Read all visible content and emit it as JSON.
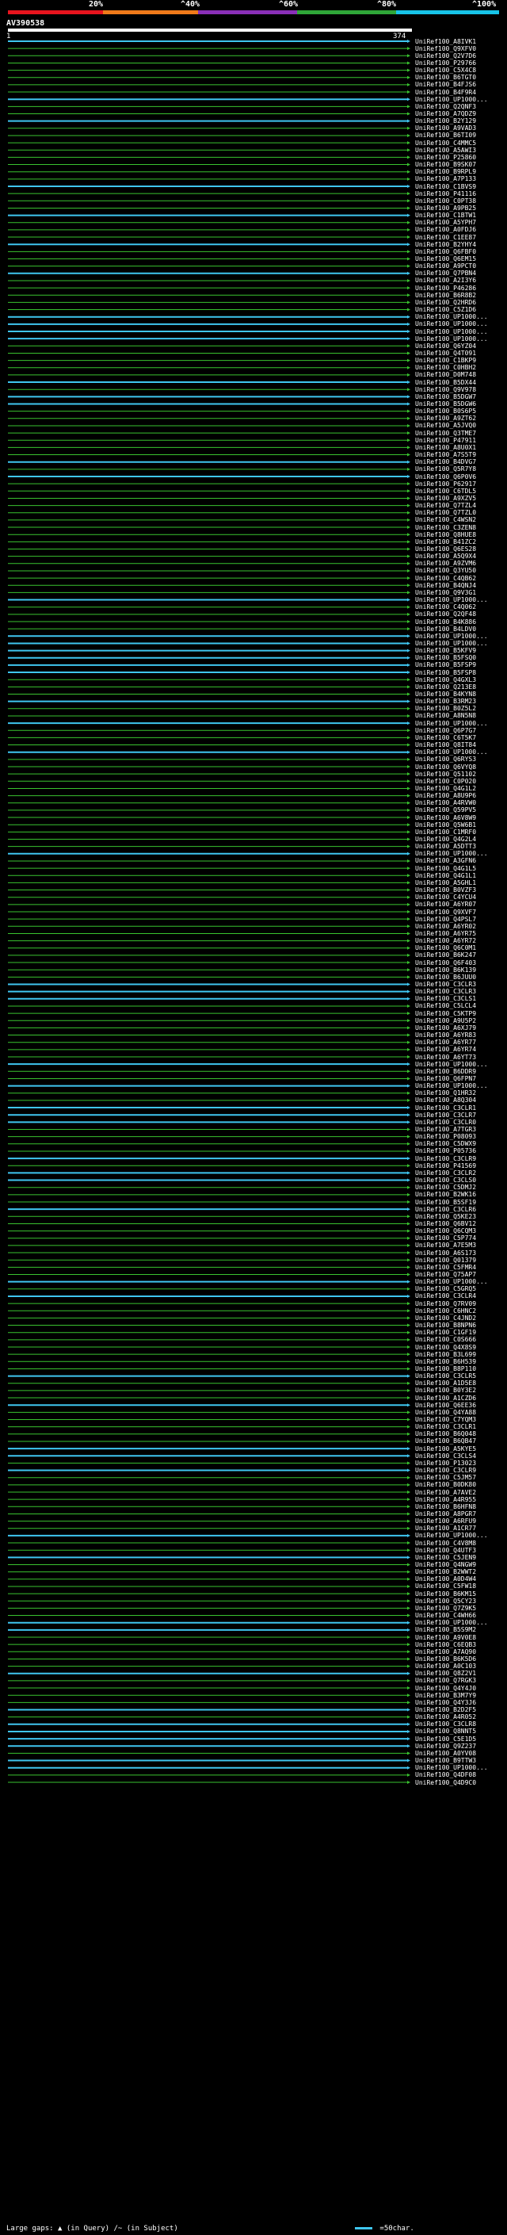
{
  "legend": {
    "ticks": [
      "20%",
      "^40%",
      "^60%",
      "^80%",
      "^100%"
    ],
    "colors": [
      "#e8141e",
      "#f07a1a",
      "#8a2fb8",
      "#2fa638",
      "#17c4e8"
    ]
  },
  "query": {
    "name": "AV390538",
    "start": "1",
    "end": "374"
  },
  "colors": {
    "green": "#39c22f",
    "cyan": "#3fc6f0",
    "stub": "#1f5a1f"
  },
  "hits": [
    {
      "label": "UniRef100_A8IVK1",
      "kind": "cyan"
    },
    {
      "label": "UniRef100_Q9XFV0",
      "kind": "green"
    },
    {
      "label": "UniRef100_Q2V7D6",
      "kind": "green"
    },
    {
      "label": "UniRef100_P29766",
      "kind": "green"
    },
    {
      "label": "UniRef100_C5X4C8",
      "kind": "green"
    },
    {
      "label": "UniRef100_B6TGT0",
      "kind": "green"
    },
    {
      "label": "UniRef100_B4FJS6",
      "kind": "green"
    },
    {
      "label": "UniRef100_B4F9R4",
      "kind": "green"
    },
    {
      "label": "UniRef100_UP1000...",
      "kind": "cyan"
    },
    {
      "label": "UniRef100_Q2QNF3",
      "kind": "green"
    },
    {
      "label": "UniRef100_A7QDZ9",
      "kind": "green"
    },
    {
      "label": "UniRef100_B2Y129",
      "kind": "cyan"
    },
    {
      "label": "UniRef100_A9VAD3",
      "kind": "green"
    },
    {
      "label": "UniRef100_B6TI09",
      "kind": "green"
    },
    {
      "label": "UniRef100_C4MMC5",
      "kind": "green"
    },
    {
      "label": "UniRef100_A5AWI3",
      "kind": "green"
    },
    {
      "label": "UniRef100_P25860",
      "kind": "green"
    },
    {
      "label": "UniRef100_B9SK07",
      "kind": "green"
    },
    {
      "label": "UniRef100_B9RPL9",
      "kind": "green"
    },
    {
      "label": "UniRef100_A7P133",
      "kind": "green"
    },
    {
      "label": "UniRef100_C1BVS9",
      "kind": "cyan"
    },
    {
      "label": "UniRef100_P41116",
      "kind": "green"
    },
    {
      "label": "UniRef100_C0PT38",
      "kind": "green"
    },
    {
      "label": "UniRef100_A9PB25",
      "kind": "green"
    },
    {
      "label": "UniRef100_C1BTW1",
      "kind": "cyan"
    },
    {
      "label": "UniRef100_A5YPH7",
      "kind": "green"
    },
    {
      "label": "UniRef100_A0FDJ6",
      "kind": "green"
    },
    {
      "label": "UniRef100_C1EE87",
      "kind": "green"
    },
    {
      "label": "UniRef100_B2YHY4",
      "kind": "cyan"
    },
    {
      "label": "UniRef100_Q6FBF0",
      "kind": "green"
    },
    {
      "label": "UniRef100_Q6EM15",
      "kind": "green"
    },
    {
      "label": "UniRef100_A9PCT0",
      "kind": "green"
    },
    {
      "label": "UniRef100_Q7PBN4",
      "kind": "cyan"
    },
    {
      "label": "UniRef100_A2I3Y6",
      "kind": "green"
    },
    {
      "label": "UniRef100_P46286",
      "kind": "green"
    },
    {
      "label": "UniRef100_B6R8B2",
      "kind": "green"
    },
    {
      "label": "UniRef100_Q2HRD6",
      "kind": "green"
    },
    {
      "label": "UniRef100_C5Z1D6",
      "kind": "green"
    },
    {
      "label": "UniRef100_UP1000...",
      "kind": "cyan"
    },
    {
      "label": "UniRef100_UP1000...",
      "kind": "cyan"
    },
    {
      "label": "UniRef100_UP1000...",
      "kind": "cyan"
    },
    {
      "label": "UniRef100_UP1000...",
      "kind": "cyan"
    },
    {
      "label": "UniRef100_Q6YZ04",
      "kind": "green"
    },
    {
      "label": "UniRef100_Q4T091",
      "kind": "green"
    },
    {
      "label": "UniRef100_C1BKP9",
      "kind": "green"
    },
    {
      "label": "UniRef100_C0HBH2",
      "kind": "green"
    },
    {
      "label": "UniRef100_D0M748",
      "kind": "green"
    },
    {
      "label": "UniRef100_B5DX44",
      "kind": "cyan"
    },
    {
      "label": "UniRef100_Q9V978",
      "kind": "green"
    },
    {
      "label": "UniRef100_B5DGW7",
      "kind": "cyan"
    },
    {
      "label": "UniRef100_B5DGW6",
      "kind": "cyan"
    },
    {
      "label": "UniRef100_B0S6P5",
      "kind": "green"
    },
    {
      "label": "UniRef100_A9ZT62",
      "kind": "green"
    },
    {
      "label": "UniRef100_A5JVQ0",
      "kind": "green"
    },
    {
      "label": "UniRef100_Q3TME7",
      "kind": "green"
    },
    {
      "label": "UniRef100_P47911",
      "kind": "green"
    },
    {
      "label": "UniRef100_A8U0X1",
      "kind": "green"
    },
    {
      "label": "UniRef100_A7S5T9",
      "kind": "green"
    },
    {
      "label": "UniRef100_B4DVG7",
      "kind": "cyan"
    },
    {
      "label": "UniRef100_Q5R7Y8",
      "kind": "green"
    },
    {
      "label": "UniRef100_Q6P0V6",
      "kind": "cyan"
    },
    {
      "label": "UniRef100_P62917",
      "kind": "green"
    },
    {
      "label": "UniRef100_C6TDL5",
      "kind": "green"
    },
    {
      "label": "UniRef100_A9XZV5",
      "kind": "green"
    },
    {
      "label": "UniRef100_Q7TZL4",
      "kind": "green"
    },
    {
      "label": "UniRef100_Q7TZL0",
      "kind": "green"
    },
    {
      "label": "UniRef100_C4WSN2",
      "kind": "green"
    },
    {
      "label": "UniRef100_C3ZEN8",
      "kind": "green"
    },
    {
      "label": "UniRef100_Q8HUE8",
      "kind": "green"
    },
    {
      "label": "UniRef100_B41ZC2",
      "kind": "green"
    },
    {
      "label": "UniRef100_Q6ES28",
      "kind": "green"
    },
    {
      "label": "UniRef100_A5Q9X4",
      "kind": "green"
    },
    {
      "label": "UniRef100_A9ZVM6",
      "kind": "green"
    },
    {
      "label": "UniRef100_Q3YU50",
      "kind": "green"
    },
    {
      "label": "UniRef100_C4QB62",
      "kind": "green"
    },
    {
      "label": "UniRef100_B4QNJ4",
      "kind": "green"
    },
    {
      "label": "UniRef100_Q9V3G1",
      "kind": "green"
    },
    {
      "label": "UniRef100_UP1000...",
      "kind": "cyan"
    },
    {
      "label": "UniRef100_C4Q062",
      "kind": "green"
    },
    {
      "label": "UniRef100_Q2QF48",
      "kind": "green"
    },
    {
      "label": "UniRef100_B4K886",
      "kind": "green"
    },
    {
      "label": "UniRef100_B4LDV0",
      "kind": "green"
    },
    {
      "label": "UniRef100_UP1000...",
      "kind": "cyan"
    },
    {
      "label": "UniRef100_UP1000...",
      "kind": "cyan"
    },
    {
      "label": "UniRef100_B5KFV9",
      "kind": "cyan"
    },
    {
      "label": "UniRef100_B5FSQ0",
      "kind": "cyan"
    },
    {
      "label": "UniRef100_B5FSP9",
      "kind": "cyan"
    },
    {
      "label": "UniRef100_B5FSP8",
      "kind": "cyan"
    },
    {
      "label": "UniRef100_Q4GXL3",
      "kind": "green"
    },
    {
      "label": "UniRef100_Q213E8",
      "kind": "green"
    },
    {
      "label": "UniRef100_B4KYN8",
      "kind": "green"
    },
    {
      "label": "UniRef100_B3RM23",
      "kind": "cyan"
    },
    {
      "label": "UniRef100_B0Z5L2",
      "kind": "green"
    },
    {
      "label": "UniRef100_A8N5N8",
      "kind": "green"
    },
    {
      "label": "UniRef100_UP1000...",
      "kind": "cyan"
    },
    {
      "label": "UniRef100_Q6P7G7",
      "kind": "green"
    },
    {
      "label": "UniRef100_C6T5K7",
      "kind": "green"
    },
    {
      "label": "UniRef100_Q8IT84",
      "kind": "green"
    },
    {
      "label": "UniRef100_UP1000...",
      "kind": "cyan"
    },
    {
      "label": "UniRef100_Q6RYS3",
      "kind": "green"
    },
    {
      "label": "UniRef100_Q6VYQ8",
      "kind": "green"
    },
    {
      "label": "UniRef100_Q51102",
      "kind": "green"
    },
    {
      "label": "UniRef100_C0P020",
      "kind": "green"
    },
    {
      "label": "UniRef100_Q4G1L2",
      "kind": "green"
    },
    {
      "label": "UniRef100_A8U9P6",
      "kind": "green"
    },
    {
      "label": "UniRef100_A4RVW0",
      "kind": "green"
    },
    {
      "label": "UniRef100_Q59PV5",
      "kind": "green"
    },
    {
      "label": "UniRef100_A6V8W9",
      "kind": "green"
    },
    {
      "label": "UniRef100_Q5W6B1",
      "kind": "green"
    },
    {
      "label": "UniRef100_C1MRF0",
      "kind": "green"
    },
    {
      "label": "UniRef100_Q4G2L4",
      "kind": "green"
    },
    {
      "label": "UniRef100_A5DTT3",
      "kind": "green"
    },
    {
      "label": "UniRef100_UP1000...",
      "kind": "cyan"
    },
    {
      "label": "UniRef100_A3GFN6",
      "kind": "green"
    },
    {
      "label": "UniRef100_Q4G1L5",
      "kind": "green"
    },
    {
      "label": "UniRef100_Q4G1L1",
      "kind": "green"
    },
    {
      "label": "UniRef100_A5GHL1",
      "kind": "green"
    },
    {
      "label": "UniRef100_B0VZF3",
      "kind": "green"
    },
    {
      "label": "UniRef100_C4YCU4",
      "kind": "green"
    },
    {
      "label": "UniRef100_A6YR07",
      "kind": "green"
    },
    {
      "label": "UniRef100_Q9XVF7",
      "kind": "green"
    },
    {
      "label": "UniRef100_Q4PSL7",
      "kind": "green"
    },
    {
      "label": "UniRef100_A6YR02",
      "kind": "green"
    },
    {
      "label": "UniRef100_A6YR75",
      "kind": "green"
    },
    {
      "label": "UniRef100_A6YR72",
      "kind": "green"
    },
    {
      "label": "UniRef100_Q6C0M1",
      "kind": "green"
    },
    {
      "label": "UniRef100_B6K247",
      "kind": "green"
    },
    {
      "label": "UniRef100_Q6F403",
      "kind": "green"
    },
    {
      "label": "UniRef100_B6K139",
      "kind": "green"
    },
    {
      "label": "UniRef100_B6JUU0",
      "kind": "green"
    },
    {
      "label": "UniRef100_C3CLR3",
      "kind": "cyan"
    },
    {
      "label": "UniRef100_C3CLR3",
      "kind": "cyan"
    },
    {
      "label": "UniRef100_C3CLS1",
      "kind": "cyan"
    },
    {
      "label": "UniRef100_C5LCL4",
      "kind": "green"
    },
    {
      "label": "UniRef100_C5KTP9",
      "kind": "green"
    },
    {
      "label": "UniRef100_A9U5P2",
      "kind": "green"
    },
    {
      "label": "UniRef100_A6XJ79",
      "kind": "green"
    },
    {
      "label": "UniRef100_A6YR83",
      "kind": "green"
    },
    {
      "label": "UniRef100_A6YR77",
      "kind": "green"
    },
    {
      "label": "UniRef100_A6YR74",
      "kind": "green"
    },
    {
      "label": "UniRef100_A6YT73",
      "kind": "green"
    },
    {
      "label": "UniRef100_UP1000...",
      "kind": "cyan"
    },
    {
      "label": "UniRef100_B6DDR9",
      "kind": "green"
    },
    {
      "label": "UniRef100_Q6FPN7",
      "kind": "green"
    },
    {
      "label": "UniRef100_UP1000...",
      "kind": "cyan"
    },
    {
      "label": "UniRef100_Q1HR32",
      "kind": "green"
    },
    {
      "label": "UniRef100_A8Q304",
      "kind": "green"
    },
    {
      "label": "UniRef100_C3CLR1",
      "kind": "cyan"
    },
    {
      "label": "UniRef100_C3CLR7",
      "kind": "cyan"
    },
    {
      "label": "UniRef100_C3CLR0",
      "kind": "cyan"
    },
    {
      "label": "UniRef100_A7TGR3",
      "kind": "green"
    },
    {
      "label": "UniRef100_P08093",
      "kind": "green"
    },
    {
      "label": "UniRef100_C5DWX9",
      "kind": "green"
    },
    {
      "label": "UniRef100_P05736",
      "kind": "green"
    },
    {
      "label": "UniRef100_C3CLR9",
      "kind": "cyan"
    },
    {
      "label": "UniRef100_P41569",
      "kind": "green"
    },
    {
      "label": "UniRef100_C3CLR2",
      "kind": "cyan"
    },
    {
      "label": "UniRef100_C3CLS0",
      "kind": "cyan"
    },
    {
      "label": "UniRef100_C5DMJ2",
      "kind": "green"
    },
    {
      "label": "UniRef100_B2WK16",
      "kind": "green"
    },
    {
      "label": "UniRef100_B5SF19",
      "kind": "green"
    },
    {
      "label": "UniRef100_C3CLR6",
      "kind": "cyan"
    },
    {
      "label": "UniRef100_Q5KE23",
      "kind": "green"
    },
    {
      "label": "UniRef100_Q6BV12",
      "kind": "green"
    },
    {
      "label": "UniRef100_Q6CQM3",
      "kind": "green"
    },
    {
      "label": "UniRef100_C5P774",
      "kind": "green"
    },
    {
      "label": "UniRef100_A7E5M3",
      "kind": "green"
    },
    {
      "label": "UniRef100_A6S173",
      "kind": "green"
    },
    {
      "label": "UniRef100_Q01379",
      "kind": "green"
    },
    {
      "label": "UniRef100_C5FMR4",
      "kind": "green"
    },
    {
      "label": "UniRef100_Q75AP7",
      "kind": "green"
    },
    {
      "label": "UniRef100_UP1000...",
      "kind": "cyan"
    },
    {
      "label": "UniRef100_C5GRQ5",
      "kind": "green"
    },
    {
      "label": "UniRef100_C3CLR4",
      "kind": "cyan"
    },
    {
      "label": "UniRef100_Q7RV09",
      "kind": "green"
    },
    {
      "label": "UniRef100_C6HNC2",
      "kind": "green"
    },
    {
      "label": "UniRef100_C4JND2",
      "kind": "green"
    },
    {
      "label": "UniRef100_B8NPN6",
      "kind": "green"
    },
    {
      "label": "UniRef100_C1GF19",
      "kind": "green"
    },
    {
      "label": "UniRef100_C0S666",
      "kind": "green"
    },
    {
      "label": "UniRef100_Q4X8S9",
      "kind": "green"
    },
    {
      "label": "UniRef100_B3L699",
      "kind": "green"
    },
    {
      "label": "UniRef100_B6H539",
      "kind": "green"
    },
    {
      "label": "UniRef100_B8P110",
      "kind": "green"
    },
    {
      "label": "UniRef100_C3CLR5",
      "kind": "cyan"
    },
    {
      "label": "UniRef100_A1D5E8",
      "kind": "green"
    },
    {
      "label": "UniRef100_B0Y3E2",
      "kind": "green"
    },
    {
      "label": "UniRef100_A1CZD6",
      "kind": "green"
    },
    {
      "label": "UniRef100_Q6EE36",
      "kind": "cyan"
    },
    {
      "label": "UniRef100_Q4YA88",
      "kind": "green"
    },
    {
      "label": "UniRef100_C7YQM3",
      "kind": "green"
    },
    {
      "label": "UniRef100_C3CLR1",
      "kind": "green"
    },
    {
      "label": "UniRef100_B6Q048",
      "kind": "green"
    },
    {
      "label": "UniRef100_B6QB47",
      "kind": "green"
    },
    {
      "label": "UniRef100_A5KYE5",
      "kind": "cyan"
    },
    {
      "label": "UniRef100_C3CLS4",
      "kind": "cyan"
    },
    {
      "label": "UniRef100_P13023",
      "kind": "green"
    },
    {
      "label": "UniRef100_C3CLR9",
      "kind": "cyan"
    },
    {
      "label": "UniRef100_C5JM57",
      "kind": "green"
    },
    {
      "label": "UniRef100_B0DK80",
      "kind": "green"
    },
    {
      "label": "UniRef100_A7AVE2",
      "kind": "green"
    },
    {
      "label": "UniRef100_A4R955",
      "kind": "green"
    },
    {
      "label": "UniRef100_B6HFN8",
      "kind": "green"
    },
    {
      "label": "UniRef100_A8PGR7",
      "kind": "green"
    },
    {
      "label": "UniRef100_A6RFU9",
      "kind": "green"
    },
    {
      "label": "UniRef100_A1CR77",
      "kind": "green"
    },
    {
      "label": "UniRef100_UP1000...",
      "kind": "cyan"
    },
    {
      "label": "UniRef100_C4V8M8",
      "kind": "green"
    },
    {
      "label": "UniRef100_Q4UTF3",
      "kind": "green"
    },
    {
      "label": "UniRef100_C5JEN9",
      "kind": "cyan"
    },
    {
      "label": "UniRef100_Q4NGW9",
      "kind": "green"
    },
    {
      "label": "UniRef100_B2WWT2",
      "kind": "green"
    },
    {
      "label": "UniRef100_A0D4W4",
      "kind": "green"
    },
    {
      "label": "UniRef100_C5FW18",
      "kind": "green"
    },
    {
      "label": "UniRef100_B6KM15",
      "kind": "green"
    },
    {
      "label": "UniRef100_Q5CY23",
      "kind": "green"
    },
    {
      "label": "UniRef100_Q7Z9K5",
      "kind": "green"
    },
    {
      "label": "UniRef100_C4WH66",
      "kind": "green"
    },
    {
      "label": "UniRef100_UP1000...",
      "kind": "cyan"
    },
    {
      "label": "UniRef100_B5S9M2",
      "kind": "cyan"
    },
    {
      "label": "UniRef100_A9V0E8",
      "kind": "green"
    },
    {
      "label": "UniRef100_C6EQB3",
      "kind": "green"
    },
    {
      "label": "UniRef100_A7AQ90",
      "kind": "green"
    },
    {
      "label": "UniRef100_B6K5D6",
      "kind": "green"
    },
    {
      "label": "UniRef100_A0C103",
      "kind": "green"
    },
    {
      "label": "UniRef100_Q8Z2V1",
      "kind": "cyan"
    },
    {
      "label": "UniRef100_Q7RGK3",
      "kind": "green"
    },
    {
      "label": "UniRef100_Q4Y4J0",
      "kind": "green"
    },
    {
      "label": "UniRef100_B3M7Y9",
      "kind": "green"
    },
    {
      "label": "UniRef100_Q4Y3J6",
      "kind": "green"
    },
    {
      "label": "UniRef100_B2D2F5",
      "kind": "cyan"
    },
    {
      "label": "UniRef100_A4R052",
      "kind": "green"
    },
    {
      "label": "UniRef100_C3CLR8",
      "kind": "cyan"
    },
    {
      "label": "UniRef100_Q8NNT5",
      "kind": "cyan"
    },
    {
      "label": "UniRef100_C5E1D5",
      "kind": "cyan"
    },
    {
      "label": "UniRef100_Q9Z237",
      "kind": "cyan"
    },
    {
      "label": "UniRef100_A0YV08",
      "kind": "green"
    },
    {
      "label": "UniRef100_B9TTW3",
      "kind": "cyan"
    },
    {
      "label": "UniRef100_UP1000...",
      "kind": "cyan"
    },
    {
      "label": "UniRef100_Q4DF08",
      "kind": "green"
    },
    {
      "label": "UniRef100_Q4D9C0",
      "kind": "green"
    }
  ],
  "footer": {
    "gaps_label": "Large gaps:",
    "query_gap_text": "(in Query)",
    "subject_gap_text": "/~ (in Subject)",
    "scale_text": "=50char."
  }
}
